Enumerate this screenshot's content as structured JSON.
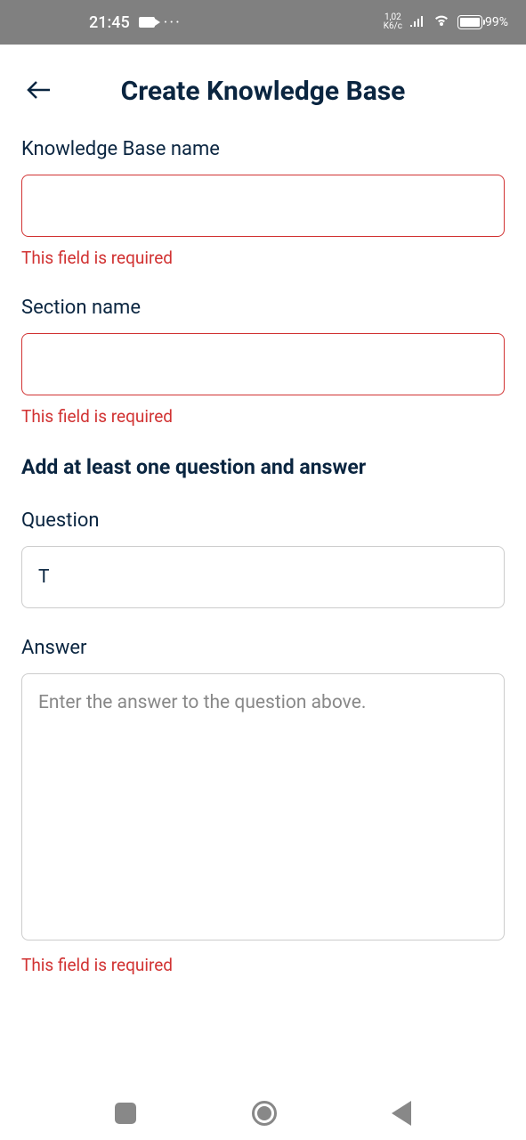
{
  "statusBar": {
    "time": "21:45",
    "speedTop": "1,02",
    "speedBottom": "K6/c",
    "batteryPercent": "99%"
  },
  "header": {
    "title": "Create Knowledge Base"
  },
  "form": {
    "kbName": {
      "label": "Knowledge Base name",
      "value": "",
      "error": "This field is required"
    },
    "sectionName": {
      "label": "Section name",
      "value": "",
      "error": "This field is required"
    },
    "subheading": "Add at least one question and answer",
    "question": {
      "label": "Question",
      "value": "T"
    },
    "answer": {
      "label": "Answer",
      "value": "",
      "placeholder": "Enter the answer to the question above.",
      "error": "This field is required"
    }
  }
}
